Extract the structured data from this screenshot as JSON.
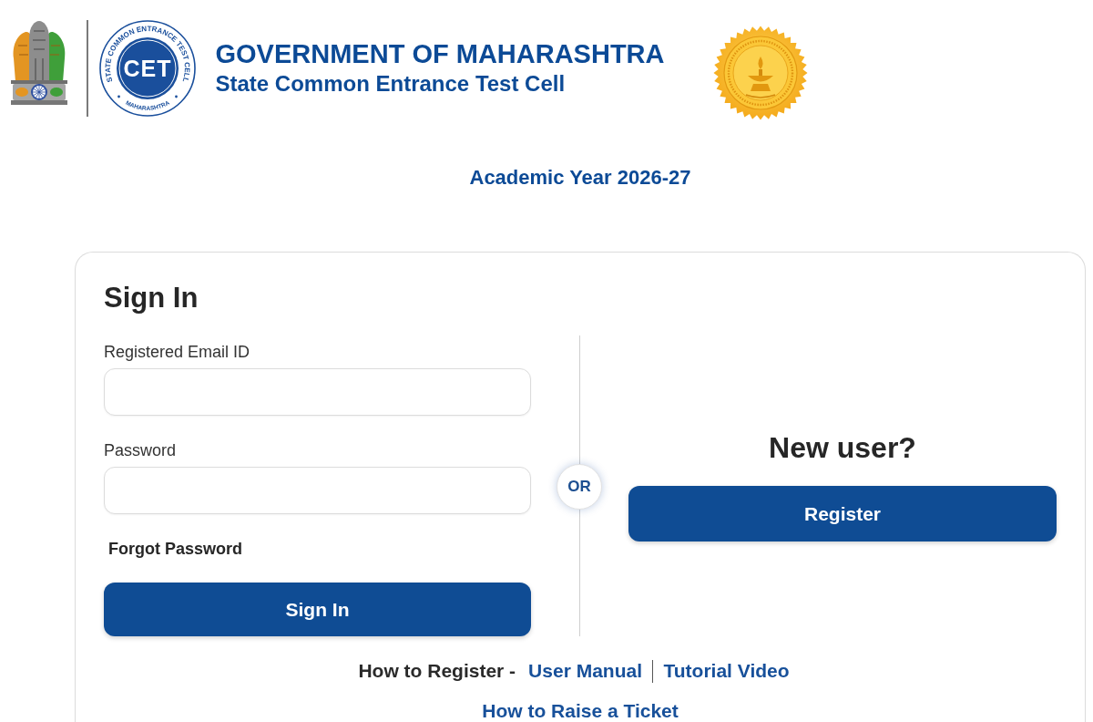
{
  "header": {
    "cet_logo": {
      "ring_text": "STATE COMMON ENTRANCE TEST CELL",
      "center_text": "CET",
      "bottom_text": "MAHARASHTRA"
    },
    "title": "GOVERNMENT OF MAHARASHTRA",
    "subtitle": "State Common Entrance Test Cell"
  },
  "academic_year": "Academic Year 2026-27",
  "sign_in": {
    "heading": "Sign In",
    "fields": [
      {
        "label": "Registered Email ID"
      },
      {
        "label": "Password"
      }
    ],
    "forgot_password": "Forgot Password",
    "button": "Sign In"
  },
  "separator": "OR",
  "new_user": {
    "heading": "New user?",
    "button": "Register"
  },
  "help": {
    "prefix": "How to Register -",
    "links": [
      "User Manual",
      "Tutorial Video"
    ],
    "ticket_link": "How to Raise a Ticket"
  }
}
